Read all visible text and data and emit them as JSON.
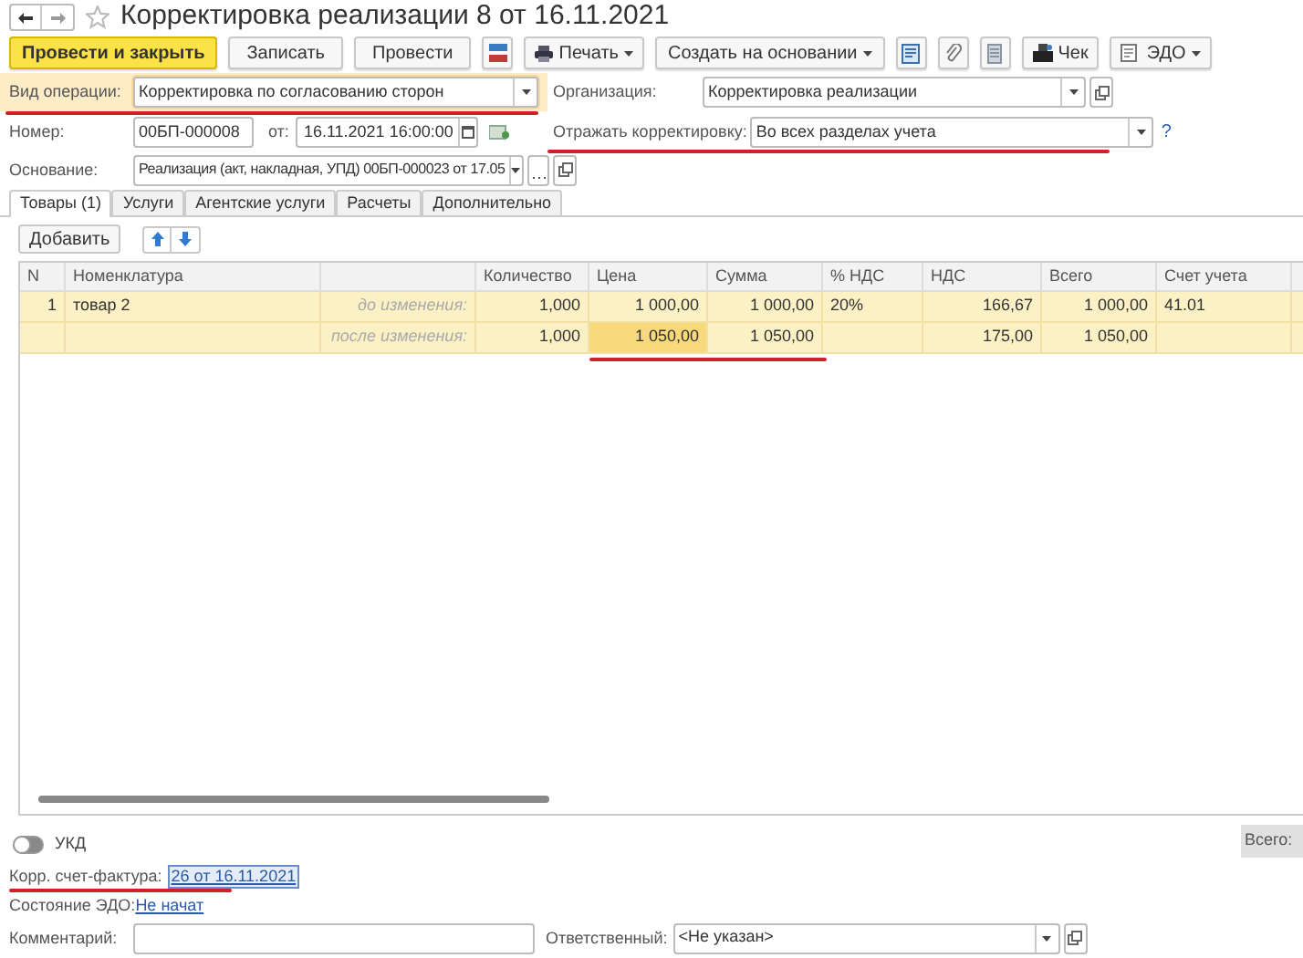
{
  "window": {
    "title": "Корректировка реализации 8 от 16.11.2021",
    "favorite": false
  },
  "toolbar": [
    {
      "kind": "primary",
      "label": "Провести и закрыть"
    },
    {
      "kind": "button",
      "label": "Записать"
    },
    {
      "kind": "button",
      "label": "Провести"
    },
    {
      "kind": "ledger"
    },
    {
      "kind": "print",
      "label": "Печать"
    },
    {
      "kind": "menu",
      "label": "Создать на основании"
    },
    {
      "kind": "copy"
    },
    {
      "kind": "clip"
    },
    {
      "kind": "doc"
    },
    {
      "kind": "receipt",
      "label": "Чек"
    },
    {
      "kind": "edo",
      "label": "ЭДО"
    }
  ],
  "fields": {
    "operation": {
      "label": "Вид операции:",
      "value": "Корректировка по согласованию сторон"
    },
    "organization": {
      "label": "Организация:",
      "value": "Корректировка реализации"
    },
    "number": {
      "label": "Номер:",
      "value": "00БП-000008"
    },
    "date": {
      "label": "от:",
      "value": "16.11.2021 16:00:00"
    },
    "reflect": {
      "label": "Отражать корректировку:",
      "value": "Во всех разделах учета",
      "help": "?"
    },
    "basis": {
      "label": "Основание:",
      "value": "Реализация (акт, накладная, УПД) 00БП-000023 от 17.05"
    }
  },
  "tabs": [
    {
      "label": "Товары (1)",
      "selected": true
    },
    {
      "label": "Услуги",
      "selected": false
    },
    {
      "label": "Агентские услуги",
      "selected": false
    },
    {
      "label": "Расчеты",
      "selected": false
    },
    {
      "label": "Дополнительно",
      "selected": false
    }
  ],
  "table_toolbar": {
    "add": "Добавить"
  },
  "table": {
    "columns": [
      "N",
      "Номенклатура",
      "",
      "Количество",
      "Цена",
      "Сумма",
      "% НДС",
      "НДС",
      "Всего",
      "Счет учета"
    ],
    "rows": [
      {
        "cells": [
          {
            "text": "1",
            "selected": false
          },
          {
            "text": "товар 2",
            "selected": false
          },
          {
            "text": "до изменения:",
            "selected": false
          },
          {
            "text": "1,000",
            "selected": false
          },
          {
            "text": "1 000,00",
            "selected": false
          },
          {
            "text": "1 000,00",
            "selected": false
          },
          {
            "text": "20%",
            "selected": false
          },
          {
            "text": "166,67",
            "selected": false
          },
          {
            "text": "1 000,00",
            "selected": false
          },
          {
            "text": "41.01",
            "selected": false
          }
        ]
      },
      {
        "cells": [
          {
            "text": "",
            "selected": false
          },
          {
            "text": "",
            "selected": false
          },
          {
            "text": "после изменения:",
            "selected": false
          },
          {
            "text": "1,000",
            "selected": false
          },
          {
            "text": "1 050,00",
            "selected": true
          },
          {
            "text": "1 050,00",
            "selected": false
          },
          {
            "text": "",
            "selected": false
          },
          {
            "text": "175,00",
            "selected": false
          },
          {
            "text": "1 050,00",
            "selected": false
          },
          {
            "text": "",
            "selected": false
          }
        ]
      }
    ]
  },
  "ukd": {
    "label": "УКД",
    "on": false
  },
  "total": {
    "label": "Всего:"
  },
  "footer": {
    "invoice_label": "Корр. счет-фактура:",
    "invoice_link": "26 от 16.11.2021",
    "edo_label": "Состояние ЭДО:",
    "edo_link": "Не начат",
    "comment_label": "Комментарий:",
    "responsible_label": "Ответственный:",
    "responsible_value": "<Не указан>"
  }
}
